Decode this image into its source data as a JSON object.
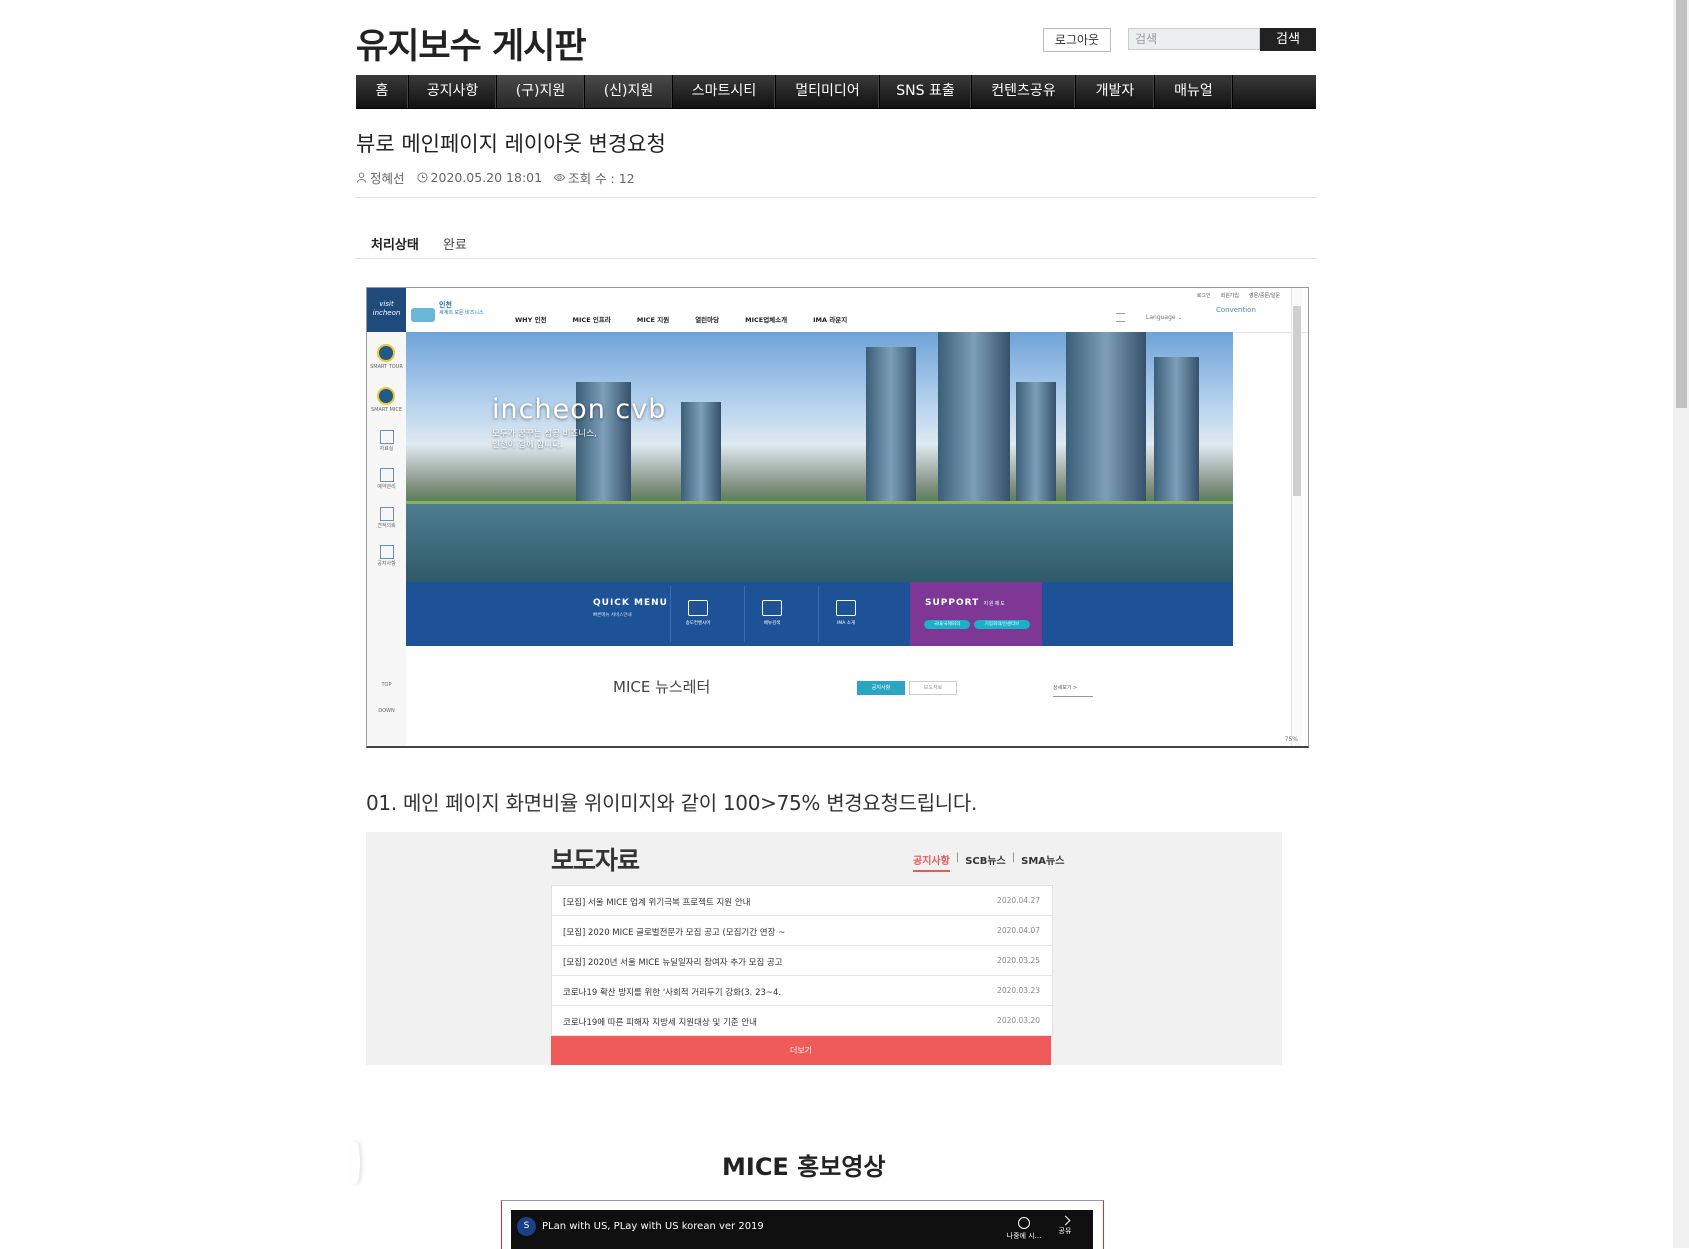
{
  "header": {
    "site_title": "유지보수 게시판",
    "logout_label": "로그아웃",
    "search_placeholder": "검색",
    "search_button": "검색"
  },
  "nav": {
    "items": [
      "홈",
      "공지사항",
      "(구)지원",
      "(신)지원",
      "스마트시티",
      "멀티미디어",
      "SNS 표출",
      "컨텐츠공유",
      "개발자",
      "매뉴얼"
    ]
  },
  "post": {
    "title": "뷰로 메인페이지 레이아웃 변경요청",
    "author": "정혜선",
    "datetime": "2020.05.20 18:01",
    "views": "조회 수 : 12",
    "status_label": "처리상태",
    "status_value": "완료"
  },
  "screenshot1": {
    "logo_text": "visit incheon",
    "top_links": [
      "로그인",
      "회원가입",
      "영문/중문/일문"
    ],
    "brand_name": "인천",
    "brand_sub": "세계의 모든 비즈니스",
    "menu": [
      "WHY 인천",
      "MICE 인프라",
      "MICE 지원",
      "열린마당",
      "MICE업체소개",
      "IMA 라운지"
    ],
    "language": "Language ⌄",
    "convention": "Convention",
    "hero_text": "incheon cvb",
    "hero_sub_1": "모두가 꿈꾸는 성공 비즈니스,",
    "hero_sub_2": "인천이 함께 합니다.",
    "sidebar_labels": [
      "SMART TOUR",
      "SMART MICE",
      "자료실",
      "예약관리",
      "견적의뢰",
      "공지사항",
      "TOP",
      "DOWN"
    ],
    "quick_title": "QUICK MENU",
    "quick_sub": "빠른메뉴 서비스안내",
    "quick_items": [
      "송도컨벤시아",
      "베뉴검색",
      "IMA 소개"
    ],
    "support_title": "SUPPORT",
    "support_sub": "지원제도",
    "support_tags": [
      "국내/국제회의",
      "기업회의/인센티브"
    ],
    "news_title": "MICE 뉴스레터",
    "news_tab1": "공지사항",
    "news_tab2": "보도자료",
    "news_more": "상세보기 >",
    "zoom": "75%"
  },
  "body": {
    "sentence": "01. 메인 페이지 화면비율 위이미지와 같이 100>75% 변경요청드립니다."
  },
  "press": {
    "title": "보도자료",
    "tabs": [
      "공지사항",
      "SCB뉴스",
      "SMA뉴스"
    ],
    "rows": [
      {
        "title": "[모집] 서울 MICE 업계 위기극복 프로젝트 지원 안내",
        "date": "2020.04.27"
      },
      {
        "title": "[모집] 2020 MICE 글로벌전문가 모집 공고 (모집기간 연장 ~",
        "date": "2020.04.07"
      },
      {
        "title": "[모집] 2020년 서울 MICE 뉴딜일자리 참여자 추가 모집 공고",
        "date": "2020.03.25"
      },
      {
        "title": "코로나19 확산 방지를 위한 '사회적 거리두기 강화(3. 23~4.",
        "date": "2020.03.23"
      },
      {
        "title": "코로나19에 따른 피해자 지방세 지원대상 및 기준 안내",
        "date": "2020.03.20"
      }
    ],
    "more": "더보기"
  },
  "video": {
    "heading": "MICE 홍보영상",
    "title": "PLan with US, PLay with US korean ver 2019",
    "avatar": "S",
    "later": "나중에 시...",
    "share": "공유"
  },
  "colors": {
    "nav_bg": "#1b1b1b",
    "press_more": "#ef5b59",
    "press_tab_active": "#e45c5c",
    "quick_bg": "#1d5396",
    "support_bg": "#7e3794"
  }
}
